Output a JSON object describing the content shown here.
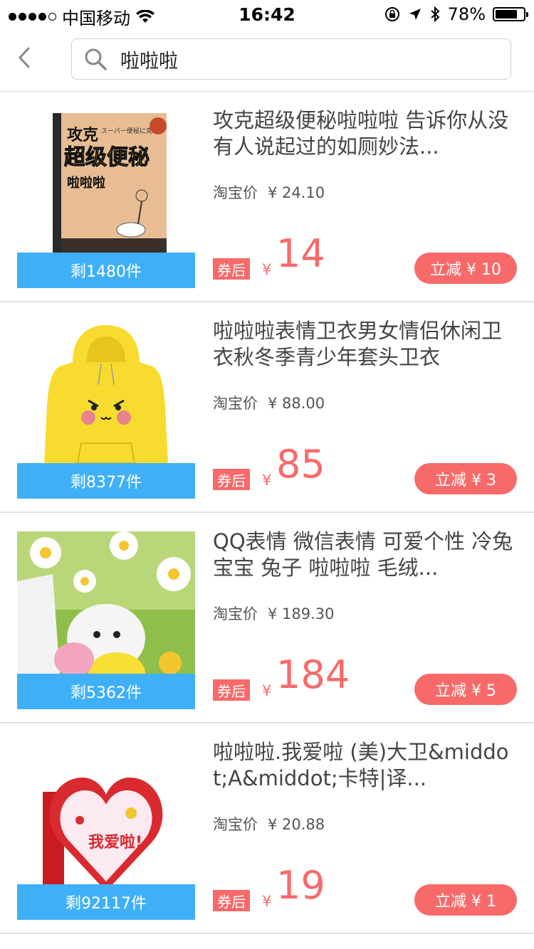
{
  "status_bar": {
    "carrier": "中国移动",
    "time": "16:42",
    "battery": "78%",
    "battery_level": 0.78
  },
  "search": {
    "value": "啦啦啦"
  },
  "products": [
    {
      "title": "攻克超级便秘啦啦啦 告诉你从没有人说起过的如厕妙法...",
      "tb_label": "淘宝价",
      "tb_price": "¥ 24.10",
      "remain": "剩1480件",
      "coupon_label": "券后",
      "currency": "¥",
      "final_price": "14",
      "discount": "立减 ¥ 10",
      "image": "book-cover-image",
      "book_cover": {
        "top_line": "攻克",
        "main_title": "超级便秘",
        "subtitle": "啦啦啦",
        "japanese": "スーパー便秘に克つ!"
      }
    },
    {
      "title": "啦啦啦表情卫衣男女情侣休闲卫衣秋冬季青少年套头卫衣",
      "tb_label": "淘宝价",
      "tb_price": "¥ 88.00",
      "remain": "剩8377件",
      "coupon_label": "券后",
      "currency": "¥",
      "final_price": "85",
      "discount": "立减 ¥ 3",
      "image": "yellow-hoodie-image"
    },
    {
      "title": "QQ表情 微信表情 可爱个性 冷兔宝宝 兔子 啦啦啦 毛绒...",
      "tb_label": "淘宝价",
      "tb_price": "¥ 189.30",
      "remain": "剩5362件",
      "coupon_label": "券后",
      "currency": "¥",
      "final_price": "184",
      "discount": "立减 ¥ 5",
      "image": "plush-toy-image"
    },
    {
      "title": "啦啦啦.我爱啦 (美)大卫&middot;A&middot;卡特|译...",
      "tb_label": "淘宝价",
      "tb_price": "¥ 20.88",
      "remain": "剩92117件",
      "coupon_label": "券后",
      "currency": "¥",
      "final_price": "19",
      "discount": "立减 ¥ 1",
      "image": "heart-book-image",
      "heart_text": "我爱啦!"
    }
  ],
  "colors": {
    "accent_red": "#f86a6a",
    "remain_blue": "#3fb0f7"
  }
}
